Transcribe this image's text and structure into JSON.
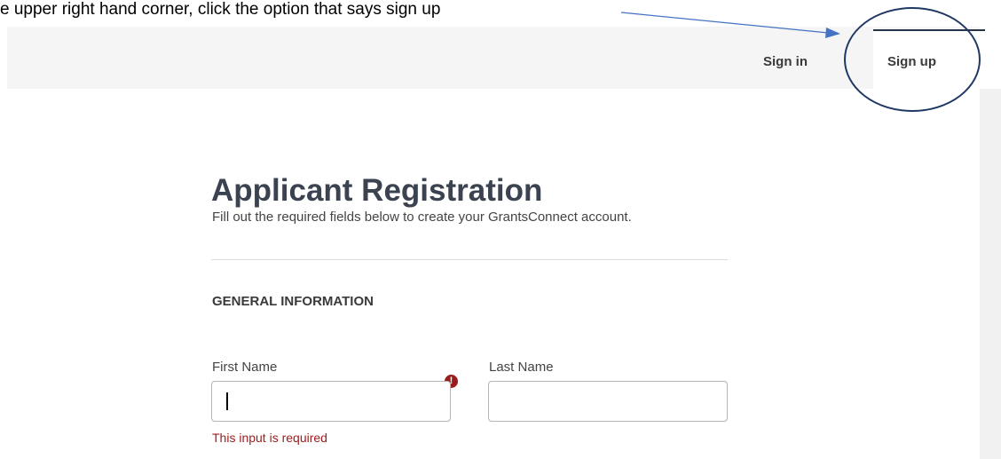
{
  "instruction": {
    "text": "e upper right hand corner, click the option that says sign up"
  },
  "topbar": {
    "sign_in_label": "Sign in",
    "sign_up_label": "Sign up"
  },
  "page": {
    "title": "Applicant Registration",
    "subtitle": "Fill out the required fields below to create your GrantsConnect account."
  },
  "section": {
    "heading": "GENERAL INFORMATION"
  },
  "fields": {
    "first_name": {
      "label": "First Name",
      "value": "",
      "error": "This input is required",
      "error_icon": "!"
    },
    "last_name": {
      "label": "Last Name",
      "value": ""
    }
  },
  "colors": {
    "annotation_arrow": "#4472c4",
    "annotation_circle": "#1f3864",
    "error": "#9b1c1c",
    "tab_border": "#26334a"
  }
}
